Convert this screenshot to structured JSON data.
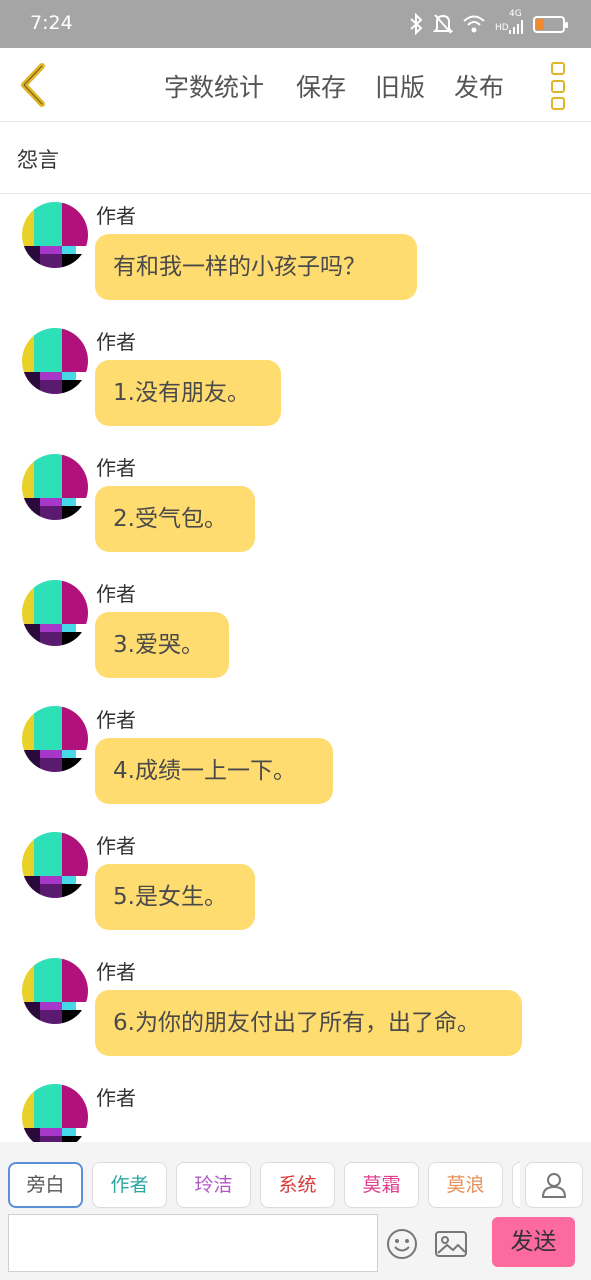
{
  "status_bar": {
    "time": "7:24",
    "network": "4G",
    "hd": "HD",
    "battery_level": 0.3,
    "battery_color": "#f28a31"
  },
  "toolbar": {
    "items": [
      "字数统计",
      "保存",
      "旧版",
      "发布"
    ],
    "accent": "#e0b628"
  },
  "title": "怨言",
  "messages": [
    {
      "author": "作者",
      "text": "有和我一样的小孩子吗？"
    },
    {
      "author": "作者",
      "text": "1.没有朋友。"
    },
    {
      "author": "作者",
      "text": "2.受气包。"
    },
    {
      "author": "作者",
      "text": "3.爱哭。"
    },
    {
      "author": "作者",
      "text": "4.成绩一上一下。"
    },
    {
      "author": "作者",
      "text": "5.是女生。"
    },
    {
      "author": "作者",
      "text": "6.为你的朋友付出了所有，出了命。"
    },
    {
      "author": "作者",
      "text": ""
    }
  ],
  "bubble_color": "#ffdc70",
  "roles": [
    {
      "label": "旁白",
      "color": "#555555",
      "active": true
    },
    {
      "label": "作者",
      "color": "#2aa7a1",
      "active": false
    },
    {
      "label": "玲洁",
      "color": "#b357c7",
      "active": false
    },
    {
      "label": "系统",
      "color": "#d83a3a",
      "active": false
    },
    {
      "label": "莫霜",
      "color": "#e0408f",
      "active": false
    },
    {
      "label": "莫浪",
      "color": "#e8905a",
      "active": false
    }
  ],
  "input": {
    "value": "",
    "placeholder": ""
  },
  "send_label": "发送",
  "send_color": "#fd6aa0",
  "icons": [
    "back-icon",
    "more-icon",
    "profile-icon",
    "emoji-icon",
    "image-icon",
    "bluetooth-icon",
    "mute-icon",
    "wifi-icon",
    "signal-icon",
    "battery-icon"
  ]
}
